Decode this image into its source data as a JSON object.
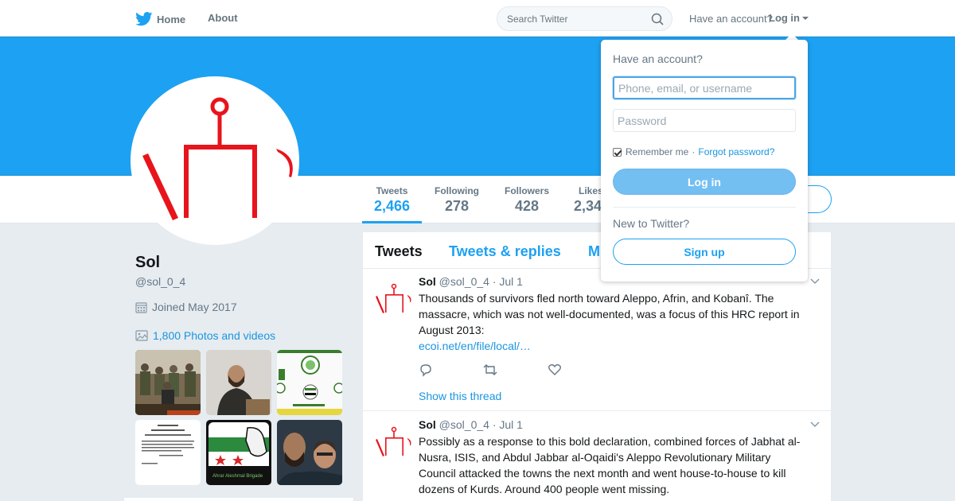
{
  "nav": {
    "home_label": "Home",
    "about_label": "About",
    "search_placeholder": "Search Twitter",
    "have_account": "Have an account?",
    "login_label": "Log in"
  },
  "profile": {
    "name": "Sol",
    "handle": "@sol_0_4",
    "joined": "Joined May 2017",
    "photos_label": "1,800 Photos and videos"
  },
  "stats": [
    {
      "label": "Tweets",
      "value": "2,466"
    },
    {
      "label": "Following",
      "value": "278"
    },
    {
      "label": "Followers",
      "value": "428"
    },
    {
      "label": "Likes",
      "value": "2,34"
    }
  ],
  "timeline": {
    "tabs": [
      "Tweets",
      "Tweets & replies",
      "M"
    ],
    "tweets": [
      {
        "name": "Sol",
        "handle": "@sol_0_4",
        "date": "· Jul 1",
        "text": "Thousands of survivors fled north toward Aleppo, Afrin, and Kobanî. The massacre, which was not well-documented, was a focus of this HRC report in August 2013:",
        "link": "ecoi.net/en/file/local/…",
        "show_thread": "Show this thread"
      },
      {
        "name": "Sol",
        "handle": "@sol_0_4",
        "date": "· Jul 1",
        "text": "Possibly as a response to this bold declaration, combined forces of Jabhat al-Nusra, ISIS, and Abdul Jabbar al-Oqaidi's Aleppo Revolutionary Military Council attacked the towns the next month and went house-to-house to kill dozens of Kurds. Around 400 people went missing."
      }
    ]
  },
  "login_dropdown": {
    "title": "Have an account?",
    "username_placeholder": "Phone, email, or username",
    "password_placeholder": "Password",
    "remember_label": "Remember me",
    "separator": "·",
    "forgot_label": "Forgot password?",
    "login_button": "Log in",
    "new_label": "New to Twitter?",
    "signup_button": "Sign up"
  },
  "thumb_text": {
    "flag_caption": "Ahrar Aleshmal Brigade"
  },
  "colors": {
    "accent": "#1da1f2",
    "banner": "#1da1f2",
    "logo_red": "#e8141c"
  },
  "icons": [
    "twitter-bird-icon",
    "search-icon",
    "calendar-icon",
    "photo-icon",
    "reply-icon",
    "retweet-icon",
    "heart-icon",
    "chevron-down-icon"
  ]
}
